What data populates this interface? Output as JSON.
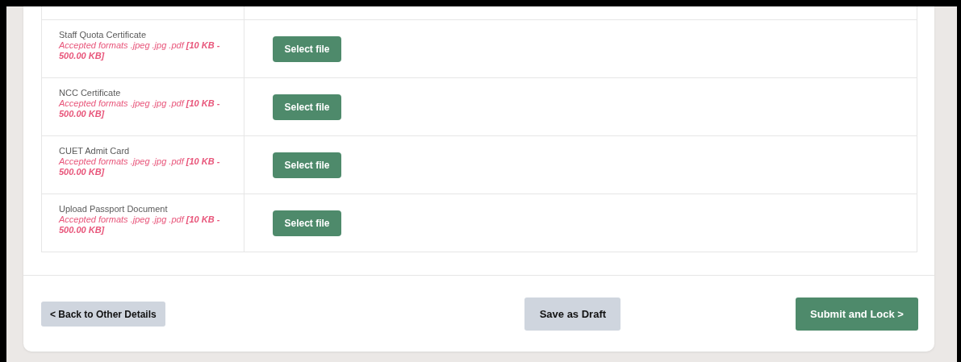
{
  "documents": [
    {
      "name": "Staff Quota Certificate",
      "formats": "Accepted formats .jpeg .jpg .pdf **[10 KB - 500.00 KB]**",
      "button": "Select file"
    },
    {
      "name": "NCC Certificate",
      "formats": "Accepted formats .jpeg .jpg .pdf **[10 KB - 500.00 KB]**",
      "button": "Select file"
    },
    {
      "name": "CUET Admit Card",
      "formats": "Accepted formats .jpeg .jpg .pdf **[10 KB - 500.00 KB]**",
      "button": "Select file"
    },
    {
      "name": "Upload Passport Document",
      "formats": "Accepted formats .jpeg .jpg .pdf **[10 KB - 500.00 KB]**",
      "button": "Select file"
    }
  ],
  "footer": {
    "back": "< Back to Other Details",
    "draft": "Save as Draft",
    "submit": "Submit and Lock >"
  }
}
